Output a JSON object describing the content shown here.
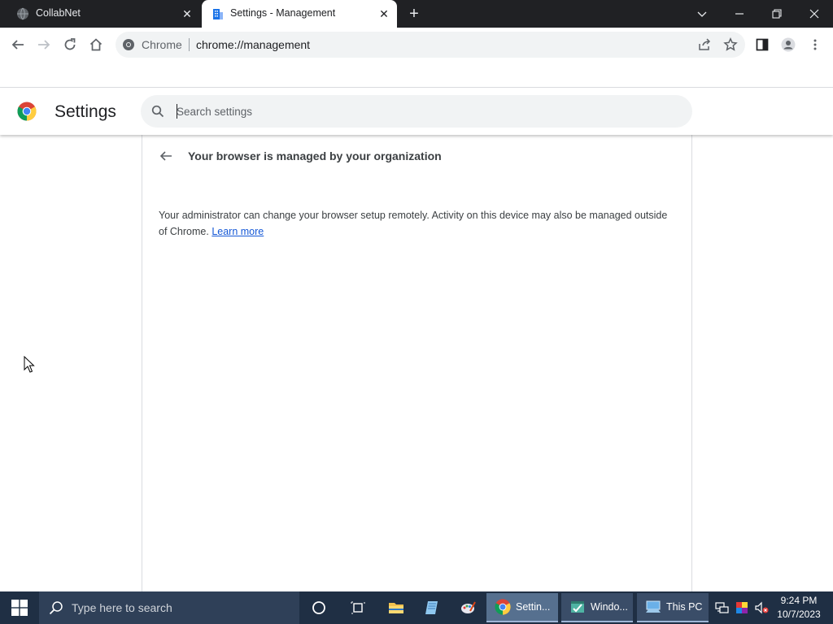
{
  "tabs": [
    {
      "title": "CollabNet",
      "active": false
    },
    {
      "title": "Settings - Management",
      "active": true
    }
  ],
  "omnibox": {
    "chip": "Chrome",
    "url": "chrome://management"
  },
  "settings": {
    "title": "Settings",
    "search_placeholder": "Search settings"
  },
  "management": {
    "heading": "Your browser is managed by your organization",
    "description": "Your administrator can change your browser setup remotely. Activity on this device may also be managed outside of Chrome.",
    "learn_more": "Learn more"
  },
  "taskbar": {
    "search_placeholder": "Type here to search",
    "apps": [
      {
        "label": "Settin...",
        "icon": "chrome-icon"
      },
      {
        "label": "Windo...",
        "icon": "window-app-icon"
      },
      {
        "label": "This PC",
        "icon": "this-pc-icon"
      }
    ],
    "time": "9:24 PM",
    "date": "10/7/2023"
  },
  "colors": {
    "accent": "#1a73e8",
    "tabstrip": "#202124",
    "taskbar": "#1f2f44"
  }
}
